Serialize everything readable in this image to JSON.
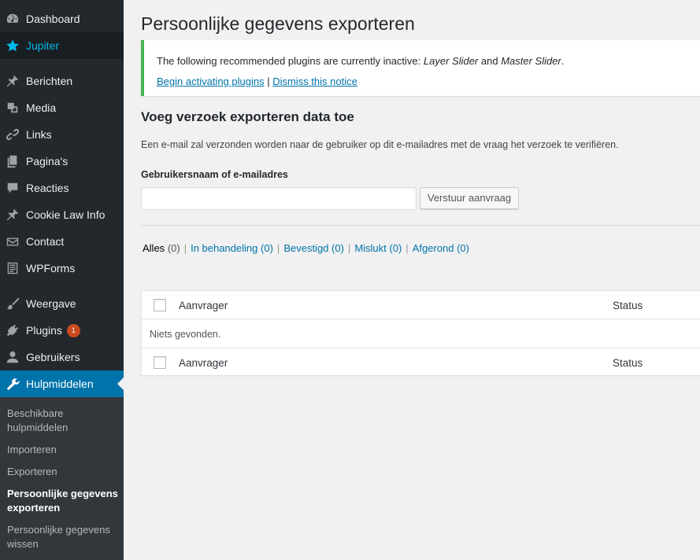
{
  "sidebar": {
    "items": [
      {
        "label": "Dashboard",
        "icon": "dashboard-icon"
      },
      {
        "label": "Jupiter",
        "icon": "star-icon"
      },
      {
        "label": "Berichten",
        "icon": "pin-icon"
      },
      {
        "label": "Media",
        "icon": "media-icon"
      },
      {
        "label": "Links",
        "icon": "link-icon"
      },
      {
        "label": "Pagina's",
        "icon": "pages-icon"
      },
      {
        "label": "Reacties",
        "icon": "comments-icon"
      },
      {
        "label": "Cookie Law Info",
        "icon": "pin-icon"
      },
      {
        "label": "Contact",
        "icon": "mail-icon"
      },
      {
        "label": "WPForms",
        "icon": "forms-icon"
      },
      {
        "label": "Weergave",
        "icon": "brush-icon"
      },
      {
        "label": "Plugins",
        "icon": "plugin-icon",
        "badge": "1"
      },
      {
        "label": "Gebruikers",
        "icon": "user-icon"
      },
      {
        "label": "Hulpmiddelen",
        "icon": "wrench-icon"
      }
    ],
    "submenu": [
      {
        "label": "Beschikbare hulpmiddelen"
      },
      {
        "label": "Importeren"
      },
      {
        "label": "Exporteren"
      },
      {
        "label": "Persoonlijke gegevens exporteren"
      },
      {
        "label": "Persoonlijke gegevens wissen"
      }
    ]
  },
  "page": {
    "title": "Persoonlijke gegevens exporteren"
  },
  "notice": {
    "text_before": "The following recommended plugins are currently inactive: ",
    "plugin1": "Layer Slider",
    "text_and": " and ",
    "plugin2": "Master Slider",
    "text_after": ".",
    "activate_link": "Begin activating plugins",
    "separator": " | ",
    "dismiss_link": "Dismiss this notice"
  },
  "form": {
    "heading": "Voeg verzoek exporteren data toe",
    "description": "Een e-mail zal verzonden worden naar de gebruiker op dit e-mailadres met de vraag het verzoek te verifiëren.",
    "field_label": "Gebruikersnaam of e-mailadres",
    "field_value": "",
    "submit_label": "Verstuur aanvraag"
  },
  "filters": [
    {
      "label": "Alles",
      "count": "(0)"
    },
    {
      "label": "In behandeling",
      "count": "(0)"
    },
    {
      "label": "Bevestigd",
      "count": "(0)"
    },
    {
      "label": "Mislukt",
      "count": "(0)"
    },
    {
      "label": "Afgerond",
      "count": "(0)"
    }
  ],
  "table": {
    "columns": [
      "Aanvrager",
      "Status"
    ],
    "empty_message": "Niets gevonden."
  },
  "colors": {
    "sidebar_bg": "#23282d",
    "active_menu": "#0073aa",
    "link": "#0073aa",
    "notice_border": "#46b450",
    "badge": "#ca4a1f"
  }
}
